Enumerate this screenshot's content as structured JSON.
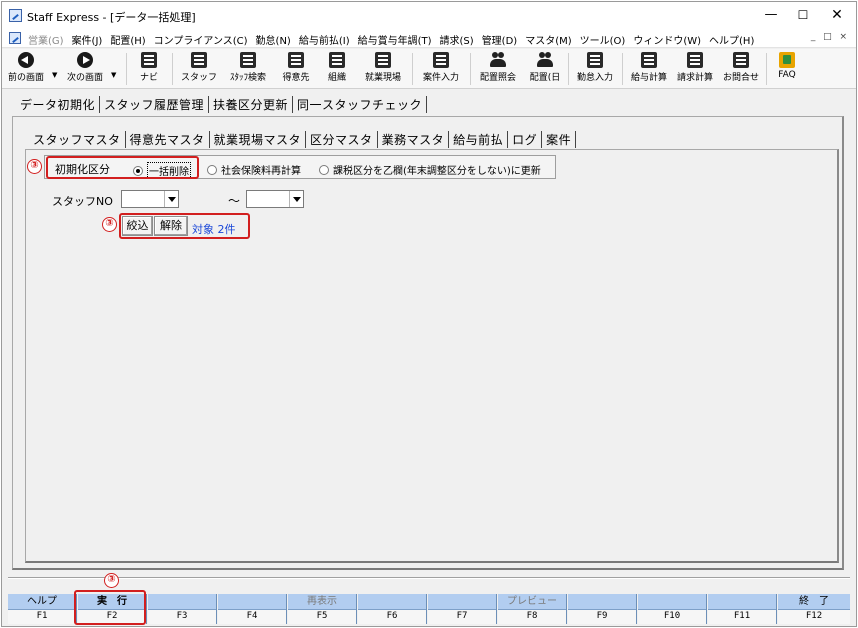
{
  "window": {
    "title": "Staff Express - [データ一括処理]"
  },
  "menu": [
    {
      "label": "営業(G)",
      "disabled": true
    },
    {
      "label": "案件(J)"
    },
    {
      "label": "配置(H)"
    },
    {
      "label": "コンプライアンス(C)"
    },
    {
      "label": "勤怠(N)"
    },
    {
      "label": "給与前払(I)"
    },
    {
      "label": "給与賞与年調(T)"
    },
    {
      "label": "請求(S)"
    },
    {
      "label": "管理(D)"
    },
    {
      "label": "マスタ(M)"
    },
    {
      "label": "ツール(O)"
    },
    {
      "label": "ウィンドウ(W)"
    },
    {
      "label": "ヘルプ(H)"
    }
  ],
  "toolbar": {
    "prev": "前の画面",
    "next": "次の画面",
    "navi": "ナビ",
    "staff": "スタッフ",
    "staff_search": "ｽﾀｯﾌ検索",
    "client": "得意先",
    "org": "組織",
    "site": "就業現場",
    "case_input": "案件入力",
    "assign_query": "配置照会",
    "assign_day": "配置(日",
    "attendance": "勤怠入力",
    "payroll": "給与計算",
    "billing": "請求計算",
    "inquiry": "お問合せ",
    "faq": "FAQ"
  },
  "outer_tabs": [
    "データ初期化",
    "スタッフ履歴管理",
    "扶養区分更新",
    "同一スタッフチェック"
  ],
  "inner_tabs": [
    "スタッフマスタ",
    "得意先マスタ",
    "就業現場マスタ",
    "区分マスタ",
    "業務マスタ",
    "給与前払",
    "ログ",
    "案件"
  ],
  "init": {
    "label": "初期化区分",
    "options": [
      "一括削除",
      "社会保険料再計算",
      "課税区分を乙欄(年末調整区分をしない)に更新"
    ],
    "selected": "一括削除"
  },
  "staff_no": {
    "label": "スタッフNO",
    "tilde": "～"
  },
  "filter": {
    "narrow": "絞込",
    "clear": "解除",
    "count": "対象 2件"
  },
  "callout": "③",
  "fkeys": [
    {
      "label": "ヘルプ",
      "key": "F1"
    },
    {
      "label": "実　行",
      "key": "F2"
    },
    {
      "label": "",
      "key": "F3"
    },
    {
      "label": "",
      "key": "F4"
    },
    {
      "label": "再表示",
      "key": "F5",
      "dim": true
    },
    {
      "label": "",
      "key": "F6"
    },
    {
      "label": "",
      "key": "F7"
    },
    {
      "label": "プレビュー",
      "key": "F8",
      "dim": true
    },
    {
      "label": "",
      "key": "F9"
    },
    {
      "label": "",
      "key": "F10"
    },
    {
      "label": "",
      "key": "F11"
    },
    {
      "label": "終　了",
      "key": "F12"
    }
  ]
}
